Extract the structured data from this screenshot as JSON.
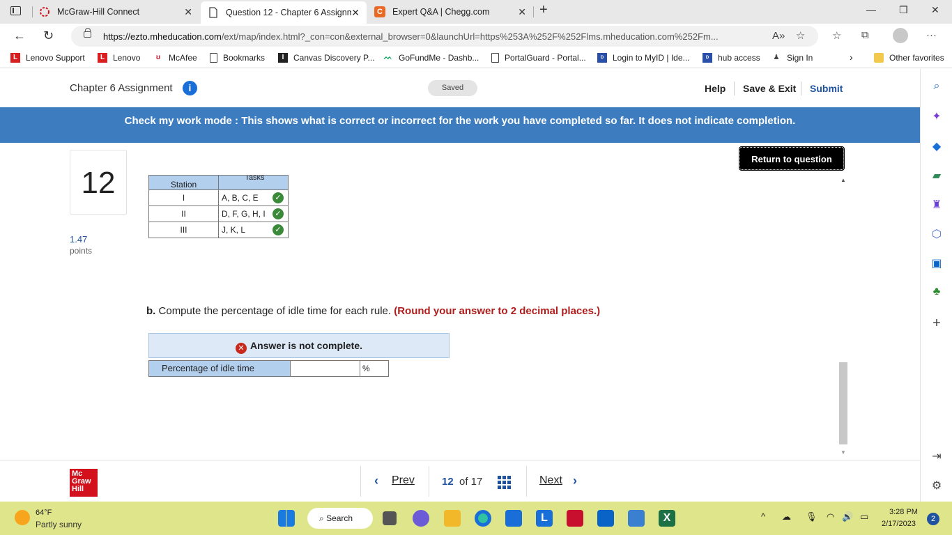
{
  "browser": {
    "tabs": [
      {
        "title": "McGraw-Hill Connect",
        "icon": "mcgraw-hill-icon"
      },
      {
        "title": "Question 12 - Chapter 6 Assignm",
        "icon": "page-icon",
        "active": true
      },
      {
        "title": "Expert Q&A | Chegg.com",
        "icon": "chegg-icon"
      }
    ],
    "new_tab": "+",
    "url_host": "https://ezto.mheducation.com",
    "url_path": "/ext/map/index.html?_con=con&external_browser=0&launchUrl=https%253A%252F%252Flms.mheducation.com%252Fm...",
    "bookmarks": [
      "Lenovo Support",
      "Lenovo",
      "McAfee",
      "Bookmarks",
      "Canvas Discovery P...",
      "GoFundMe - Dashb...",
      "PortalGuard - Portal...",
      "Login to MyID | Ide...",
      "hub access",
      "Sign In"
    ],
    "other_favorites": "Other favorites"
  },
  "header": {
    "title": "Chapter 6 Assignment",
    "saved": "Saved",
    "help": "Help",
    "save_exit": "Save & Exit",
    "submit": "Submit"
  },
  "banner": "Check my work mode : This shows what is correct or incorrect for the work you have completed so far. It does not indicate completion.",
  "question": {
    "number": "12",
    "points_value": "1.47",
    "points_label": "points",
    "return_button": "Return to question",
    "table": {
      "headers": [
        "Station",
        "Tasks"
      ],
      "rows": [
        {
          "station": "I",
          "tasks": "A, B, C, E"
        },
        {
          "station": "II",
          "tasks": "D, F, G, H, I"
        },
        {
          "station": "III",
          "tasks": "J, K, L"
        }
      ]
    },
    "part_label": "b.",
    "part_text": "Compute the percentage of idle time for each rule.",
    "part_round": "(Round your answer to 2 decimal places.)",
    "status": "Answer is not complete.",
    "answer_label": "Percentage of idle time",
    "answer_value": "",
    "answer_unit": "%"
  },
  "footer": {
    "logo_lines": [
      "Mc",
      "Graw",
      "Hill"
    ],
    "prev": "Prev",
    "next": "Next",
    "current_page": "12",
    "of_total": "of  17"
  },
  "taskbar": {
    "temperature": "64°F",
    "weather": "Partly sunny",
    "search": "Search",
    "time": "3:28 PM",
    "date": "2/17/2023",
    "notifications": "2"
  }
}
